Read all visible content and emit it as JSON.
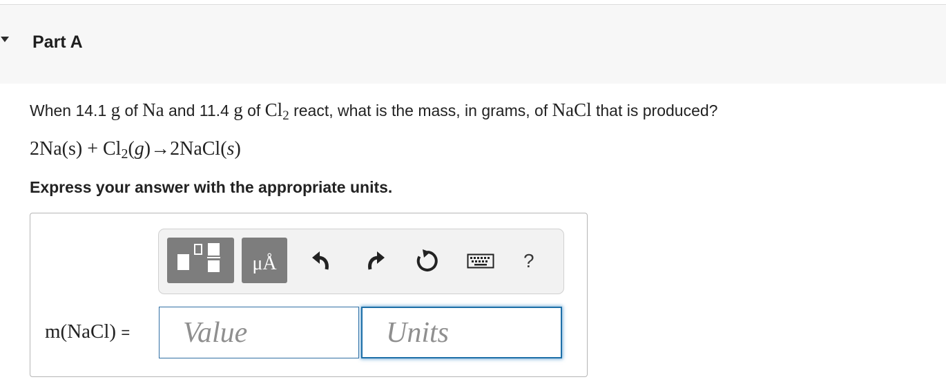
{
  "part": {
    "title": "Part A"
  },
  "question": {
    "pre": "When 14.1",
    "unit1": "g",
    "of1": "of",
    "species1": "Na",
    "and": "and 11.4",
    "unit2": "g",
    "of2": "of",
    "species2": "Cl",
    "species2_sub": "2",
    "mid": "react, what is the mass, in grams, of",
    "species3": "NaCl",
    "post": "that is produced?"
  },
  "equation": {
    "part1": "2Na(s) + Cl",
    "sub": "2",
    "part2": "(",
    "phase_g": "g",
    "part3": ")→2NaCl(",
    "phase_s": "s",
    "part4": ")"
  },
  "instruction": "Express your answer with the appropriate units.",
  "toolbar": {
    "templates_icon": "templates-icon",
    "units_label": "μÅ",
    "undo_icon": "undo-icon",
    "redo_icon": "redo-icon",
    "reset_icon": "reset-icon",
    "keyboard_icon": "keyboard-icon",
    "help_label": "?"
  },
  "answer": {
    "label": "m(NaCl)",
    "equals": "=",
    "value_placeholder": "Value",
    "units_placeholder": "Units"
  },
  "colors": {
    "header_bg": "#f7f7f7",
    "toolbar_button": "#7d7d7d",
    "input_border": "#2f6ea3",
    "focus_glow": "#3c8cc8"
  }
}
